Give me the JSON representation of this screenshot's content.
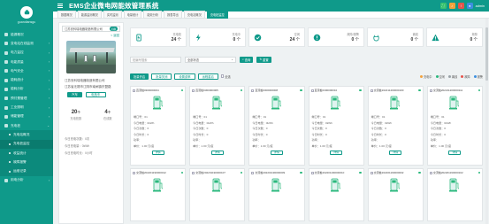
{
  "app": {
    "title": "EMS企业微电网能效管理系统",
    "user": "guandiansgu",
    "admin": "admin"
  },
  "sidebar": {
    "items": [
      {
        "label": "能源概况",
        "sub": false,
        "chev": ""
      },
      {
        "label": "变电站在线监测",
        "sub": false,
        "chev": "›"
      },
      {
        "label": "电力监控",
        "sub": false,
        "chev": "›"
      },
      {
        "label": "电能质量",
        "sub": false,
        "chev": "›"
      },
      {
        "label": "电气安全",
        "sub": false,
        "chev": "›"
      },
      {
        "label": "能耗统计",
        "sub": false,
        "chev": "›"
      },
      {
        "label": "能耗分析",
        "sub": false,
        "chev": "›"
      },
      {
        "label": "预付费管理",
        "sub": false,
        "chev": "›"
      },
      {
        "label": "工业照明",
        "sub": false,
        "chev": "›"
      },
      {
        "label": "储能管理",
        "sub": false,
        "chev": "›"
      },
      {
        "label": "充电桩",
        "sub": false,
        "chev": "⌄"
      },
      {
        "label": "充电站概况",
        "sub": true,
        "chev": ""
      },
      {
        "label": "充电桩监控",
        "sub": true,
        "chev": ""
      },
      {
        "label": "收益统计",
        "sub": true,
        "chev": ""
      },
      {
        "label": "故障报警",
        "sub": true,
        "chev": ""
      },
      {
        "label": "运维记录",
        "sub": true,
        "chev": ""
      },
      {
        "label": "用电分析",
        "sub": false,
        "chev": "›"
      }
    ]
  },
  "tabs": [
    "数据概况",
    "能源监测概况",
    "实时监测",
    "电量统计",
    "能效分析",
    "报表导出",
    "充电站概况",
    "充电桩监控"
  ],
  "panel": {
    "station": "江苏安科瑞电器制造有限公司",
    "toggle": "切换",
    "return": "< 返回",
    "company": "江苏安科瑞电器制造有限公司",
    "address": "江苏省无锡市江阴市南闸镇东盟路",
    "btn_car": "汽车",
    "btn_bike": "电瓶车",
    "stat_left_val": "20",
    "stat_left_unit": "个",
    "stat_left_label": "充电桩数",
    "stat_right_val": "4",
    "stat_right_unit": "个",
    "stat_right_label": "在线数",
    "meta": [
      "今日充电次数：0次",
      "今日充电量：0kWh",
      "今日充电时长：0小时"
    ]
  },
  "kpis": [
    {
      "label": "充电桩",
      "value": "24",
      "unit": "个",
      "icon": "charger-icon",
      "color": "#0f9a8a"
    },
    {
      "label": "充电中",
      "value": "0",
      "unit": "个",
      "icon": "bolt-icon",
      "color": "#0f9a8a"
    },
    {
      "label": "空闲",
      "value": "24",
      "unit": "个",
      "icon": "check-circle-icon",
      "color": "#0f9a8a"
    },
    {
      "label": "故障/报警",
      "value": "0",
      "unit": "个",
      "icon": "warning-circle-icon",
      "color": "#0f9a8a"
    },
    {
      "label": "离线",
      "value": "0",
      "unit": "个",
      "icon": "plug-icon",
      "color": "#0f9a8a"
    },
    {
      "label": "故障",
      "value": "0",
      "unit": "个",
      "icon": "alert-triangle-icon",
      "color": "#0f9a8a"
    }
  ],
  "filters": {
    "search_placeholder": "桩编号搜索",
    "type_select": "全部状态",
    "search_btn": "查询",
    "reset_btn": "重置"
  },
  "actions": {
    "b1": "批量开启",
    "b2": "批量关闭",
    "b3": "设置费率",
    "b4": "远程重启",
    "select_all": "全选",
    "legend": [
      {
        "label": "充电中",
        "color": "#f3a23c"
      },
      {
        "label": "空闲",
        "color": "#2ab87c"
      },
      {
        "label": "离线",
        "color": "#9aa3a8"
      },
      {
        "label": "故障",
        "color": "#e6544c"
      },
      {
        "label": "报警",
        "color": "#3d8fe0"
      }
    ]
  },
  "cards": [
    {
      "id": "直流桩0300000004",
      "port": "端口号：01",
      "energy": "今日电量：0kWh",
      "count": "今日次数：0",
      "time": "今日时长：0",
      "power": "功率：",
      "rate": "单价：1.00 元/度",
      "btn": "详情"
    },
    {
      "id": "直流桩0300000005",
      "port": "端口号：01",
      "energy": "今日电量：0kWh",
      "count": "今日次数：0",
      "time": "今日时长：0",
      "power": "功率：",
      "rate": "单价：1.00 元/度",
      "btn": "详情"
    },
    {
      "id": "直流桩0300000008",
      "port": "端口号：01",
      "energy": "今日电量：0kWh",
      "count": "今日次数：0",
      "time": "今日时长：0",
      "power": "功率：",
      "rate": "单价：1.00 元/度",
      "btn": "详情"
    },
    {
      "id": "直流桩0300000010",
      "port": "端口号：01",
      "energy": "今日电量：0kWh",
      "count": "今日次数：0",
      "time": "今日时长：0",
      "power": "功率：",
      "rate": "单价：1.00 元/度",
      "btn": "详情"
    },
    {
      "id": "交流桩202211200000100",
      "port": "端口号：01",
      "energy": "今日电量：0kWh",
      "count": "今日次数：0",
      "time": "今日时长：0",
      "power": "功率：",
      "rate": "单价：1.00 元/度",
      "btn": "详情"
    },
    {
      "id": "交流桩202211200000111",
      "port": "端口号：01",
      "energy": "今日电量：0kWh",
      "count": "今日次数：0",
      "time": "今日时长：0",
      "power": "功率：",
      "rate": "单价：1.00 元/度",
      "btn": "详情"
    },
    {
      "id": "交流桩202201190000012",
      "port": "",
      "energy": "",
      "count": "",
      "time": "",
      "power": "",
      "rate": "",
      "btn": ""
    },
    {
      "id": "交流桩202201190000107",
      "port": "",
      "energy": "",
      "count": "",
      "time": "",
      "power": "",
      "rate": "",
      "btn": ""
    },
    {
      "id": "交流桩202201190000009",
      "port": "",
      "energy": "",
      "count": "",
      "time": "",
      "power": "",
      "rate": "",
      "btn": ""
    },
    {
      "id": "交流桩202201190000010",
      "port": "",
      "energy": "",
      "count": "",
      "time": "",
      "power": "",
      "rate": "",
      "btn": ""
    },
    {
      "id": "交流桩202201190000002",
      "port": "",
      "energy": "",
      "count": "",
      "time": "",
      "power": "",
      "rate": "",
      "btn": ""
    },
    {
      "id": "交流桩202201190000102",
      "port": "",
      "energy": "",
      "count": "",
      "time": "",
      "power": "",
      "rate": "",
      "btn": ""
    }
  ],
  "colors": {
    "primary": "#0f9a8a",
    "idle": "#2ab87c"
  }
}
